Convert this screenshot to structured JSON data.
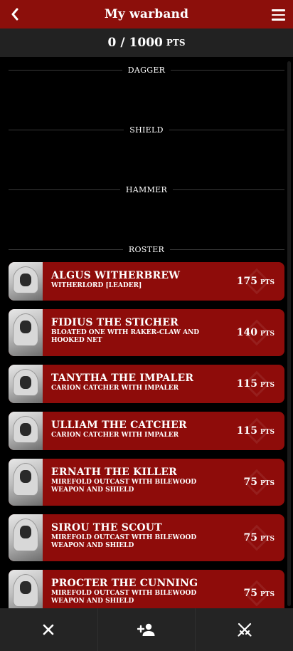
{
  "header": {
    "title": "My warband",
    "back_icon": "chevron-left-icon",
    "menu_icon": "hamburger-menu-icon",
    "color": "#8c0f0b"
  },
  "points": {
    "current": "0",
    "separator": "/",
    "max": "1000",
    "unit": "PTS"
  },
  "sections": {
    "dagger": "DAGGER",
    "shield": "SHIELD",
    "hammer": "HAMMER",
    "roster": "ROSTER"
  },
  "roster": [
    {
      "name": "ALGUS WITHERBREW",
      "desc": "WITHERLORD [LEADER]",
      "cost": "175",
      "unit": "PTS"
    },
    {
      "name": "FIDIUS THE STICHER",
      "desc": "BLOATED ONE WITH RAKER-CLAW AND HOOKED NET",
      "cost": "140",
      "unit": "PTS"
    },
    {
      "name": "TANYTHA THE IMPALER",
      "desc": "CARION CATCHER WITH IMPALER",
      "cost": "115",
      "unit": "PTS"
    },
    {
      "name": "ULLIAM THE CATCHER",
      "desc": "CARION CATCHER WITH IMPALER",
      "cost": "115",
      "unit": "PTS"
    },
    {
      "name": "ERNATH THE KILLER",
      "desc": "MIREFOLD OUTCAST WITH BILEWOOD WEAPON AND SHIELD",
      "cost": "75",
      "unit": "PTS"
    },
    {
      "name": "SIROU THE SCOUT",
      "desc": "MIREFOLD OUTCAST WITH BILEWOOD WEAPON AND SHIELD",
      "cost": "75",
      "unit": "PTS"
    },
    {
      "name": "PROCTER THE CUNNING",
      "desc": "MIREFOLD OUTCAST WITH BILEWOOD WEAPON AND SHIELD",
      "cost": "75",
      "unit": "PTS"
    }
  ],
  "bottom_bar": {
    "close_icon": "close-icon",
    "add_fighter_icon": "add-person-icon",
    "battle_icon": "crossed-swords-icon"
  }
}
